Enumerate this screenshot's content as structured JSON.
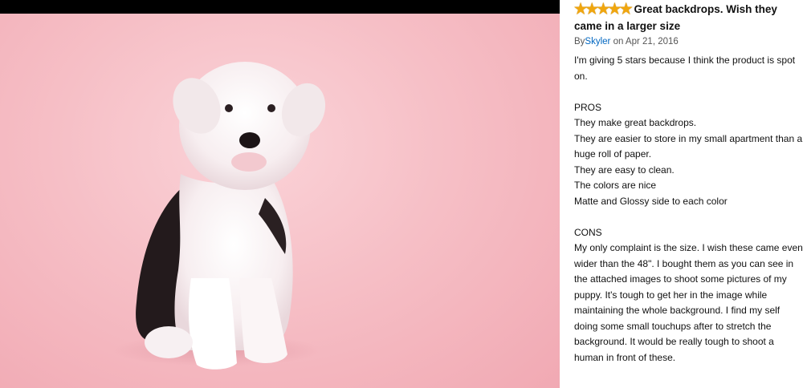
{
  "review": {
    "rating": 5,
    "rating_max": 5,
    "star_glyph": "★",
    "star_color": "#f0a60e",
    "title": "Great backdrops. Wish they came in a larger size",
    "by_prefix": "By",
    "author": "Skyler",
    "date_text": "on Apr 21, 2016",
    "intro": "I'm giving 5 stars because I think the product is spot on.",
    "pros_heading": "PROS",
    "pros": [
      "They make great backdrops.",
      "They are easier to store in my small apartment than a huge roll of paper.",
      "They are easy to clean.",
      "The colors are nice",
      "Matte and Glossy side to each color"
    ],
    "cons_heading": "CONS",
    "cons": [
      "My only complaint is the size. I wish these came even wider than the 48\". I bought them as you can see in the attached images to shoot some pictures of my puppy. It's tough to get her in the image while maintaining the whole background. I find my self doing some small touchups after to stretch the background. It would be really tough to shoot a human in front of these."
    ]
  },
  "photo": {
    "subject": "puppy-on-pink-backdrop",
    "backdrop_color": "#f6bfc6"
  }
}
